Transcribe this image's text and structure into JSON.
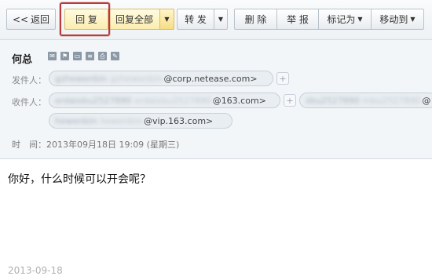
{
  "toolbar": {
    "back": "返回",
    "reply": "回 复",
    "reply_all": "回复全部",
    "forward": "转 发",
    "delete": "删 除",
    "report": "举 报",
    "mark_as": "标记为",
    "move_to": "移动到",
    "colors": {
      "highlight": "#b83a3a",
      "reply_bg": "#fbedb0"
    }
  },
  "message": {
    "subject": "何总",
    "sender_label": "发件人：",
    "sender": {
      "name": "gzhewenbin",
      "alias": "gzhewenbin",
      "domain": "@corp.netease.com>"
    },
    "recipient_label": "收件人：",
    "recipients": [
      {
        "name": "erdaixbu2527890",
        "alias": "erdaixbu2527890",
        "domain": "@163.com>"
      },
      {
        "name": "zbu2527890",
        "alias": "mbu2527890",
        "domain": "@"
      },
      {
        "name": "hewenbin",
        "alias": "hewenbin",
        "domain": "@vip.163.com>"
      }
    ],
    "time_label": "时　间：",
    "time": "2013年09月18日 19:09 (星期三)",
    "body": "你好，什么时候可以开会呢？",
    "footer_date": "2013-09-18"
  }
}
